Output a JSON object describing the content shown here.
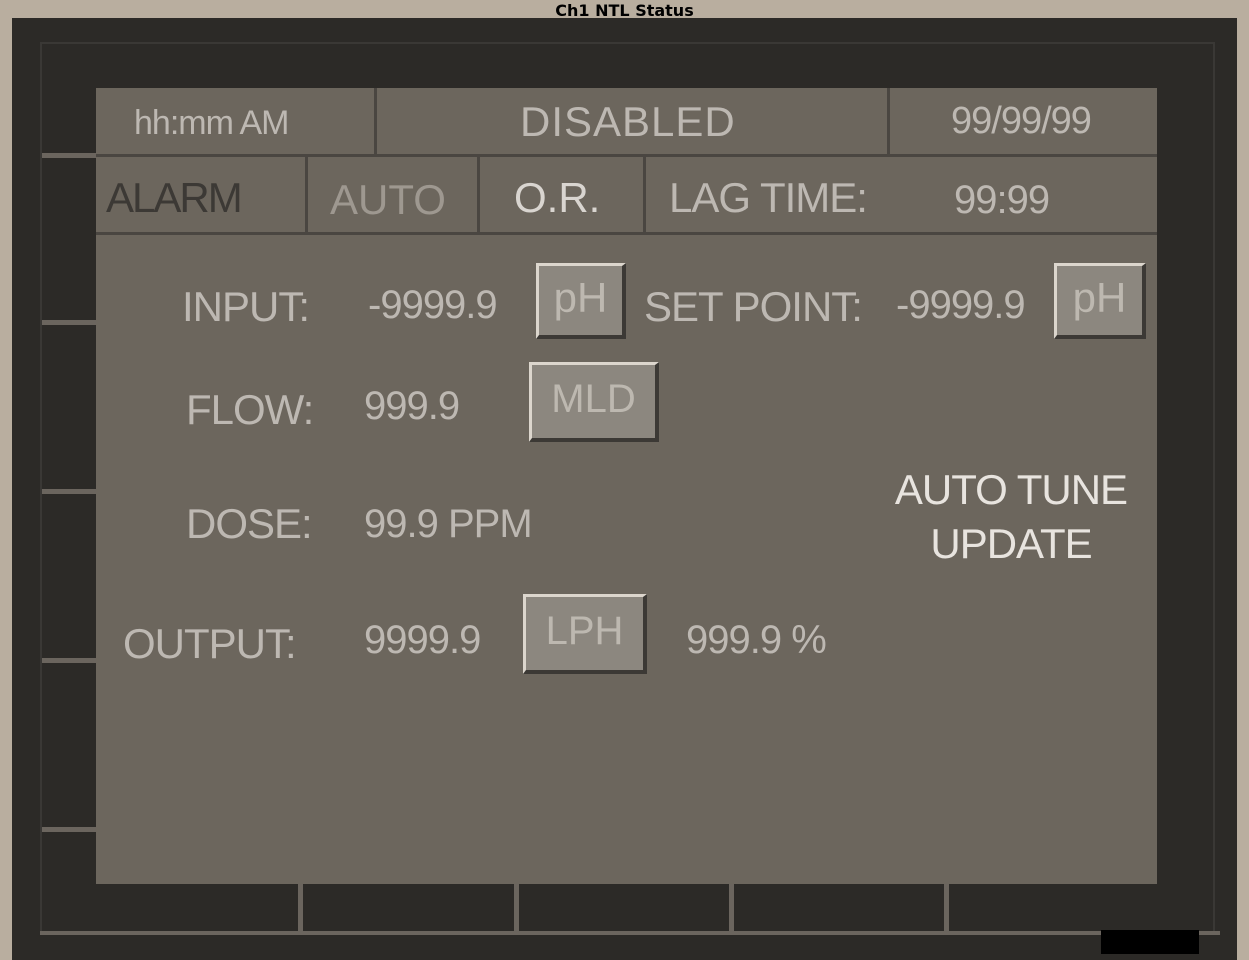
{
  "window": {
    "title": "Ch1 NTL Status"
  },
  "header": {
    "time": "hh:mm AM",
    "state": "DISABLED",
    "date": "99/99/99"
  },
  "status_row": {
    "alarm": "ALARM",
    "auto": "AUTO",
    "or": "O.R.",
    "lag_label": "LAG TIME:",
    "lag_value": "99:99"
  },
  "fields": {
    "input_label": "INPUT:",
    "input_value": "-9999.9",
    "input_unit": "pH",
    "setpoint_label": "SET POINT:",
    "setpoint_value": "-9999.9",
    "setpoint_unit": "pH",
    "flow_label": "FLOW:",
    "flow_value": "999.9",
    "flow_unit": "MLD",
    "dose_label": "DOSE:",
    "dose_value": "99.9 PPM",
    "output_label": "OUTPUT:",
    "output_value": "9999.9",
    "output_unit": "LPH",
    "output_percent": "999.9 %"
  },
  "autotune": {
    "line1": "AUTO TUNE",
    "line2": "UPDATE"
  }
}
